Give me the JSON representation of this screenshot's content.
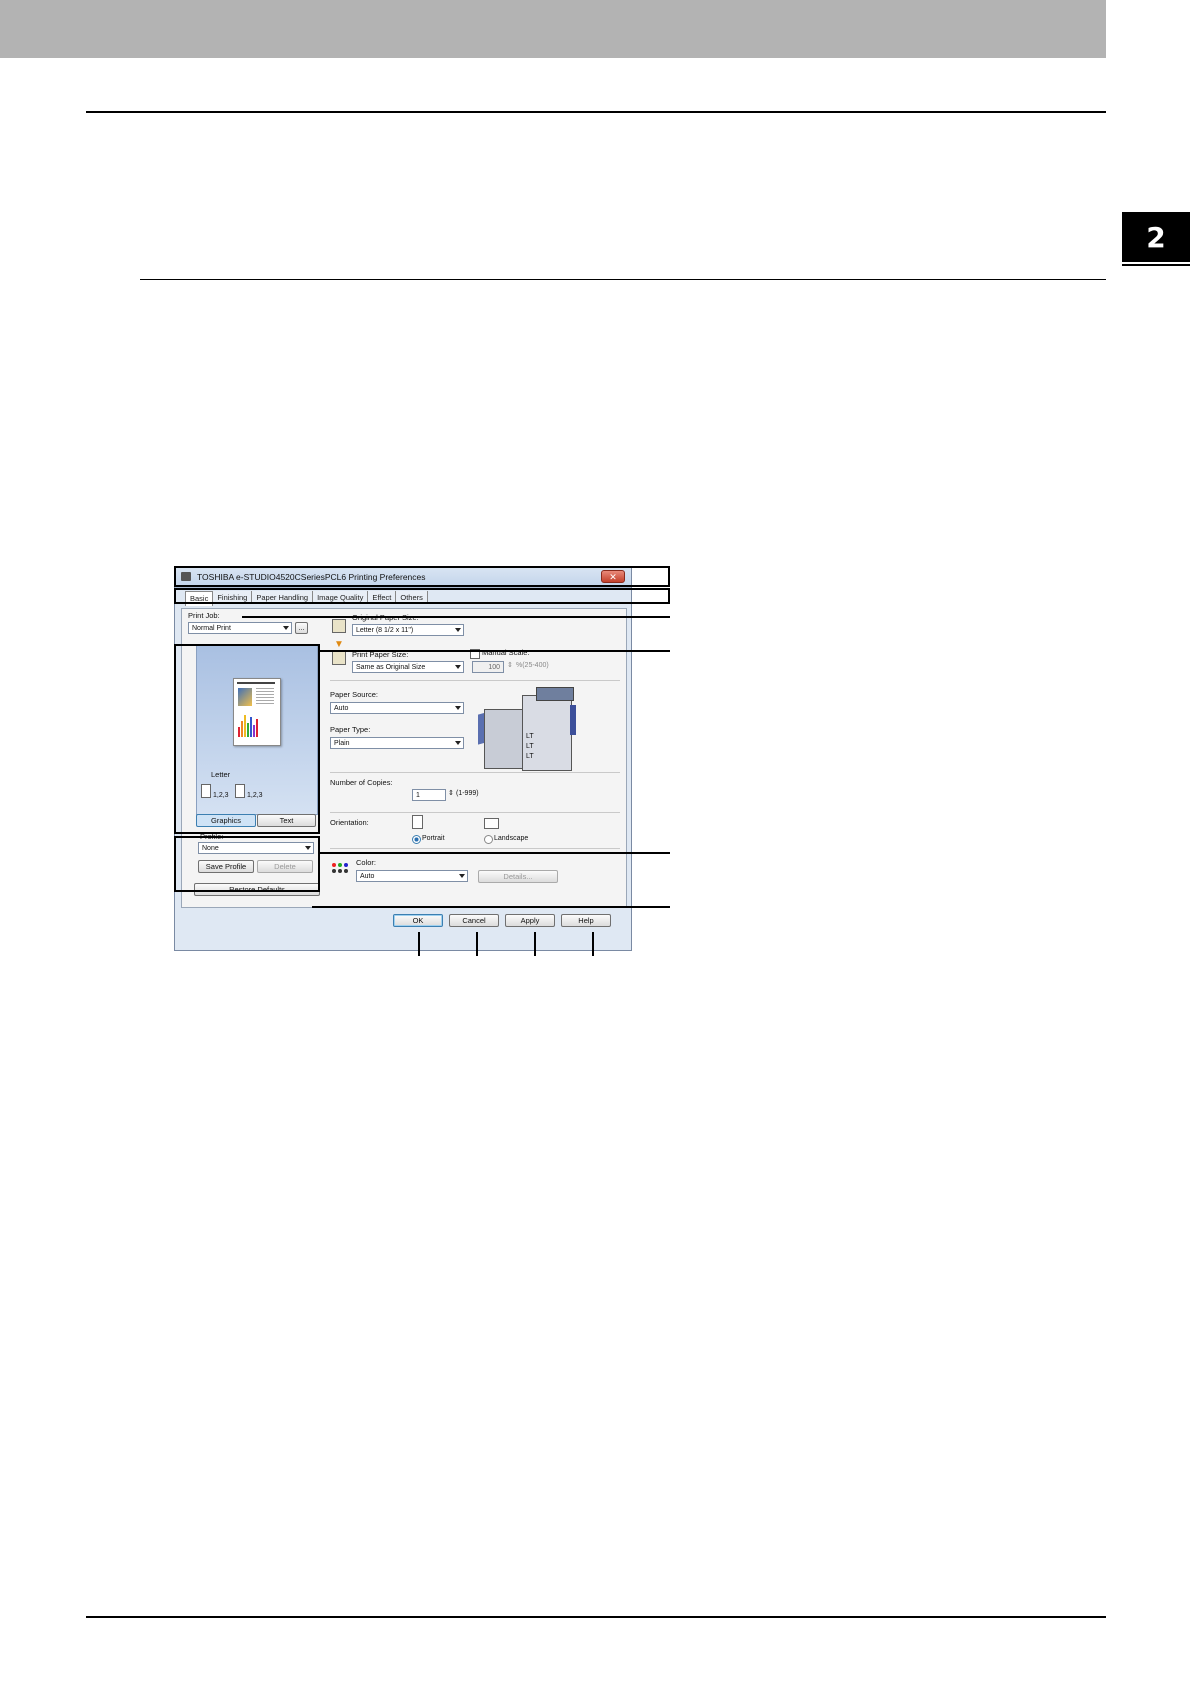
{
  "page": {
    "chapter_number": "2"
  },
  "dialog": {
    "title": "TOSHIBA e-STUDIO4520CSeriesPCL6 Printing Preferences",
    "close_glyph": "✕",
    "tabs": [
      {
        "label": "Basic",
        "active": true
      },
      {
        "label": "Finishing"
      },
      {
        "label": "Paper Handling"
      },
      {
        "label": "Image Quality"
      },
      {
        "label": "Effect"
      },
      {
        "label": "Others"
      }
    ],
    "print_job": {
      "label": "Print Job:",
      "value": "Normal Print",
      "more_button": "..."
    },
    "preview": {
      "paper_label": "Letter",
      "collate_a": "1,2,3",
      "collate_b": "1,2,3",
      "graphics_button": "Graphics",
      "text_button": "Text"
    },
    "profile": {
      "label": "Profile:",
      "value": "None",
      "save_button": "Save Profile",
      "delete_button": "Delete"
    },
    "original_paper_size": {
      "label": "Original Paper Size:",
      "value": "Letter (8 1/2 x 11\")"
    },
    "print_paper_size": {
      "label": "Print Paper Size:",
      "value": "Same as Original Size"
    },
    "manual_scale": {
      "label": "Manual Scale:",
      "value": "100",
      "range": "%(25-400)"
    },
    "paper_source": {
      "label": "Paper Source:",
      "value": "Auto"
    },
    "paper_type": {
      "label": "Paper Type:",
      "value": "Plain"
    },
    "printer_trays": [
      "LT",
      "LT",
      "LT"
    ],
    "copies": {
      "label": "Number of Copies:",
      "value": "1",
      "range": "(1-999)"
    },
    "orientation": {
      "label": "Orientation:",
      "portrait": "Portrait",
      "landscape": "Landscape"
    },
    "color": {
      "label": "Color:",
      "value": "Auto",
      "details_button": "Details..."
    },
    "restore_defaults_button": "Restore Defaults",
    "footer": {
      "ok": "OK",
      "cancel": "Cancel",
      "apply": "Apply",
      "help": "Help"
    }
  },
  "colors": {
    "top_band": "#b3b3b3",
    "dialog_bg": "#dfe8f3",
    "close_button": "#c3402b",
    "selection_blue": "#3c7fb1"
  }
}
